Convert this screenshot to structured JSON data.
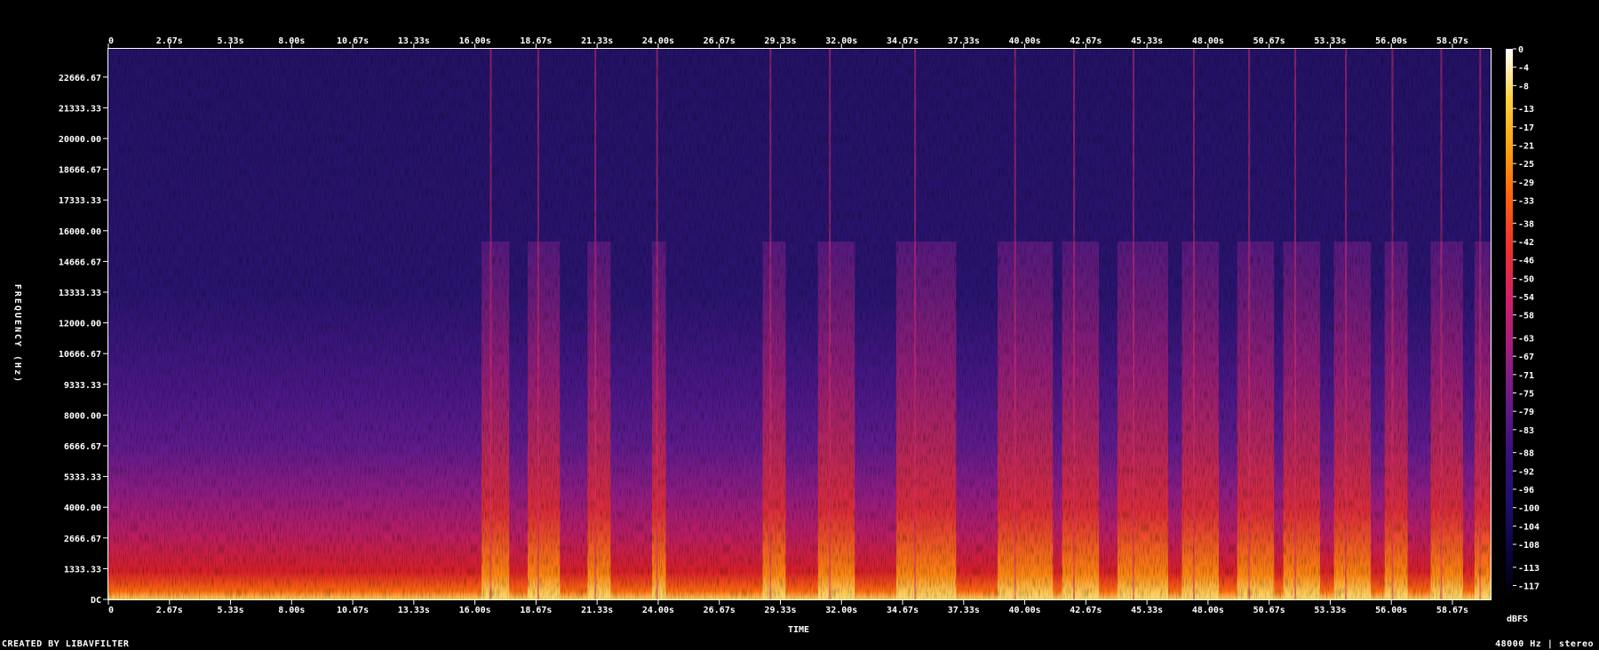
{
  "chart_data": {
    "type": "heatmap",
    "subtype": "spectrogram",
    "xlabel": "TIME",
    "ylabel": "FREQUENCY (Hz)",
    "x_ticks": [
      "0",
      "2.67s",
      "5.33s",
      "8.00s",
      "10.67s",
      "13.33s",
      "16.00s",
      "18.67s",
      "21.33s",
      "24.00s",
      "26.67s",
      "29.33s",
      "32.00s",
      "34.67s",
      "37.33s",
      "40.00s",
      "42.67s",
      "45.33s",
      "48.00s",
      "50.67s",
      "53.33s",
      "56.00s",
      "58.67s"
    ],
    "x_range": [
      0,
      60
    ],
    "y_ticks": [
      "DC",
      "1333.33",
      "2666.67",
      "4000.00",
      "5333.33",
      "6666.67",
      "8000.00",
      "9333.33",
      "10666.67",
      "12000.00",
      "13333.33",
      "14666.67",
      "16000.00",
      "17333.33",
      "18666.67",
      "20000.00",
      "21333.33",
      "22666.67"
    ],
    "y_range": [
      0,
      24000
    ],
    "colorbar_label": "dBFS",
    "colorbar_ticks": [
      "0",
      "-4",
      "-8",
      "-13",
      "-17",
      "-21",
      "-25",
      "-29",
      "-33",
      "-38",
      "-42",
      "-46",
      "-50",
      "-54",
      "-58",
      "-63",
      "-67",
      "-71",
      "-75",
      "-79",
      "-83",
      "-88",
      "-92",
      "-96",
      "-100",
      "-104",
      "-108",
      "-113",
      "-117"
    ],
    "colorbar_range": [
      -120,
      0
    ],
    "colormap": [
      "#000000",
      "#0a0540",
      "#1f0f70",
      "#3a117c",
      "#6a1b8a",
      "#a01e7e",
      "#d0206a",
      "#ee3030",
      "#ff6010",
      "#ffa010",
      "#ffd040",
      "#ffffff"
    ],
    "loud_segments_s": [
      [
        16.2,
        17.4
      ],
      [
        18.2,
        19.6
      ],
      [
        20.8,
        21.8
      ],
      [
        23.6,
        24.2
      ],
      [
        28.4,
        29.4
      ],
      [
        30.8,
        32.4
      ],
      [
        34.2,
        36.8
      ],
      [
        38.6,
        41.0
      ],
      [
        41.4,
        43.0
      ],
      [
        43.8,
        46.0
      ],
      [
        46.6,
        48.2
      ],
      [
        49.0,
        50.6
      ],
      [
        51.0,
        52.6
      ],
      [
        53.2,
        54.8
      ],
      [
        55.4,
        56.4
      ],
      [
        57.4,
        58.8
      ],
      [
        59.3,
        60.0
      ]
    ]
  },
  "footer": {
    "credit": "CREATED BY LIBAVFILTER",
    "info": "48000 Hz | stereo"
  }
}
